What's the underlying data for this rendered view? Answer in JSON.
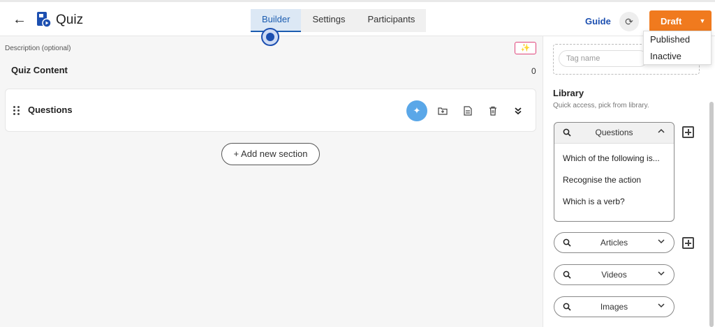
{
  "header": {
    "back_icon": "arrow-left-icon",
    "logo_icon": "quiz-logo-icon",
    "title": "Quiz",
    "tabs": [
      {
        "label": "Builder",
        "active": true
      },
      {
        "label": "Settings",
        "active": false
      },
      {
        "label": "Participants",
        "active": false
      }
    ],
    "guide_label": "Guide",
    "refresh_icon": "refresh-icon",
    "status_button": {
      "label": "Draft",
      "color": "#f07a1e"
    },
    "status_options": [
      "Published",
      "Inactive"
    ]
  },
  "main": {
    "description_label": "Description (optional)",
    "content_title": "Quiz Content",
    "content_count": "0",
    "section": {
      "title": "Questions",
      "icons": [
        "magic-wand-icon",
        "add-folder-icon",
        "document-icon",
        "trash-icon",
        "double-chevron-down-icon"
      ]
    },
    "add_section_label": "Add new section"
  },
  "sidebar": {
    "tag_placeholder": "Tag name",
    "library_title": "Library",
    "library_subtitle": "Quick access, pick from library.",
    "accordions": [
      {
        "label": "Questions",
        "expanded": true,
        "items": [
          "Which of the following is...",
          "Recognise the action",
          "Which is a verb?"
        ]
      },
      {
        "label": "Articles",
        "expanded": false
      },
      {
        "label": "Videos",
        "expanded": false
      },
      {
        "label": "Images",
        "expanded": false
      }
    ]
  },
  "colors": {
    "accent": "#1c4fb0",
    "draft": "#f07a1e",
    "magic": "#5aa7e8"
  }
}
